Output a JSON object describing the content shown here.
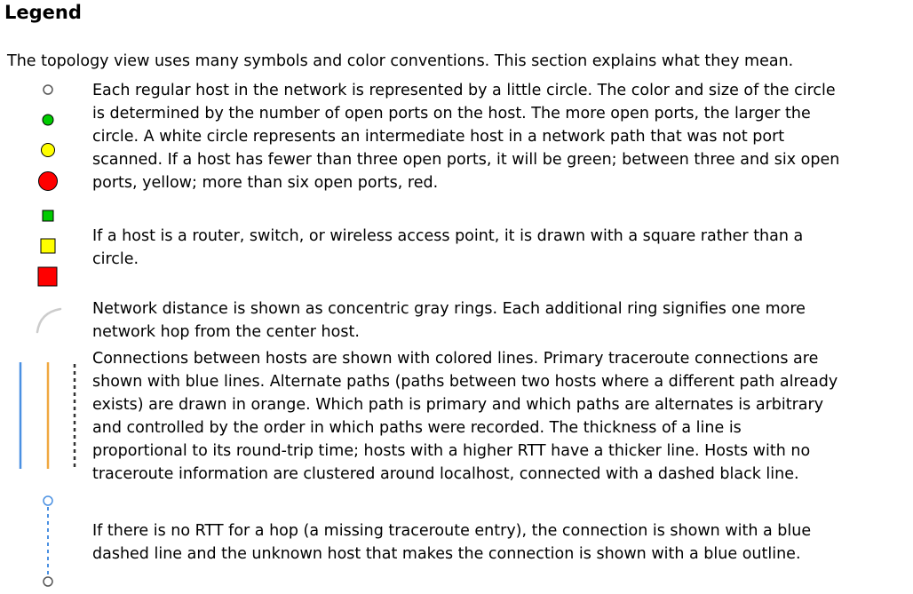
{
  "title": "Legend",
  "intro": "The topology view uses many symbols and color conventions. This section explains what they mean.",
  "sections": [
    {
      "lines": [
        "Each regular host in the network is represented by a little circle. The color and size of the circle",
        "is determined by the number of open ports on the host. The more open ports, the larger the",
        "circle. A white circle represents an intermediate host in a network path that was not port",
        "scanned. If a host has fewer than three open ports, it will be green; between three and six open",
        "ports, yellow; more than six open ports, red."
      ]
    },
    {
      "lines": [
        "If a host is a router, switch, or wireless access point, it is drawn with a square rather than a",
        "circle."
      ]
    },
    {
      "lines": [
        "Network distance is shown as concentric gray rings. Each additional ring signifies one more",
        "network hop from the center host."
      ]
    },
    {
      "lines": [
        "Connections between hosts are shown with colored lines. Primary traceroute connections are",
        "shown with blue lines. Alternate paths (paths between two hosts where a different path already",
        "exists) are drawn in orange. Which path is primary and which paths are alternates is arbitrary",
        "and controlled by the order in which paths were recorded. The thickness of a line is",
        "proportional to its round-trip time; hosts with a higher RTT have a thicker line. Hosts with no",
        "traceroute information are clustered around localhost, connected with a dashed black line."
      ]
    },
    {
      "lines": [
        "If there is no RTT for a hop (a missing traceroute entry), the connection is shown with a blue",
        "dashed line and the unknown host that makes the connection is shown with a blue outline."
      ]
    }
  ],
  "icons": {
    "host_white": "white-circle-icon",
    "host_green": "green-circle-icon",
    "host_yellow": "yellow-circle-icon",
    "host_red": "red-circle-icon",
    "router_green": "green-square-icon",
    "router_yellow": "yellow-square-icon",
    "router_red": "red-square-icon",
    "ring": "gray-ring-arc-icon",
    "primary_line": "blue-line-icon",
    "alternate_line": "orange-line-icon",
    "no_traceroute_line": "dashed-black-line-icon",
    "missing_rtt": "blue-dashed-line-icon"
  },
  "colors": {
    "green": "#00cc00",
    "yellow": "#ffff00",
    "red": "#ff0000",
    "ring_gray": "#cccccc",
    "blue": "#4a90e2",
    "orange": "#f0a840",
    "dash_black": "#333333",
    "outline": "#555555"
  }
}
